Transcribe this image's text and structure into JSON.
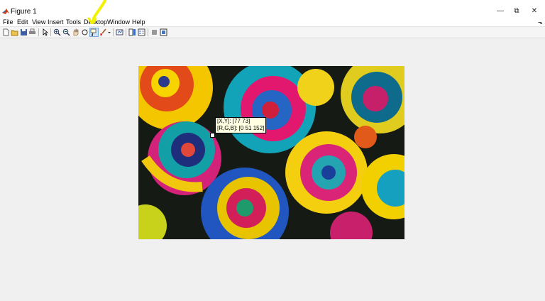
{
  "window": {
    "title": "Figure 1",
    "controls": {
      "minimize": "—",
      "maximize": "⧉",
      "close": "✕"
    }
  },
  "menubar": {
    "items": [
      "File",
      "Edit",
      "View",
      "Insert",
      "Tools",
      "Desktop",
      "Window",
      "Help"
    ],
    "dock_arrow": "⬎"
  },
  "toolbar": {
    "buttons": [
      "new-figure-icon",
      "open-file-icon",
      "save-icon",
      "print-icon",
      "select-pointer-icon",
      "zoom-in-icon",
      "zoom-out-icon",
      "pan-hand-icon",
      "rotate-3d-icon",
      "data-cursor-icon",
      "brush-icon",
      "link-plot-icon",
      "insert-colorbar-icon",
      "insert-legend-icon",
      "hide-plot-tools-icon",
      "show-plot-tools-icon"
    ],
    "active_button": "data-cursor-icon"
  },
  "datatip": {
    "xy_line": "[X,Y]: [77 73]",
    "rgb_line": "[R,G,B]: [0 51 152]"
  },
  "colors": {
    "highlighter": "#f2f200",
    "window_bg": "#f0f0f0",
    "datatip_bg": "#ffffe1"
  }
}
